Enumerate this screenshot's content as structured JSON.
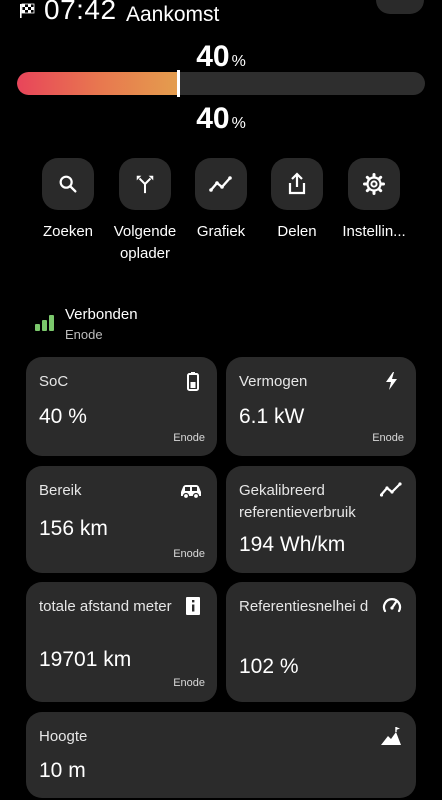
{
  "header": {
    "time": "07:42",
    "arrival_label": "Aankomst"
  },
  "battery": {
    "soc_top": "40",
    "soc_bottom": "40",
    "unit": "%",
    "level_percent": 40,
    "gradient_colors": [
      "#e8455a",
      "#e2b24d",
      "#a6d96a"
    ]
  },
  "actions": [
    {
      "label": "Zoeken",
      "icon": "search-icon"
    },
    {
      "label": "Volgende oplader",
      "icon": "fork-route-icon"
    },
    {
      "label": "Grafiek",
      "icon": "line-chart-icon"
    },
    {
      "label": "Delen",
      "icon": "share-icon"
    },
    {
      "label": "Instellin...",
      "icon": "gear-icon"
    }
  ],
  "status": {
    "title": "Verbonden",
    "subtitle": "Enode",
    "signal_color": "#7bc86c"
  },
  "cards": [
    {
      "title": "SoC",
      "value": "40 %",
      "source": "Enode",
      "icon": "battery-icon"
    },
    {
      "title": "Vermogen",
      "value": "6.1 kW",
      "source": "Enode",
      "icon": "lightning-icon"
    },
    {
      "title": "Bereik",
      "value": "156 km",
      "source": "Enode",
      "icon": "car-icon"
    },
    {
      "title": "Gekalibreerd referentieverbruik",
      "value": "194 Wh/km",
      "source": "",
      "icon": "trend-icon"
    },
    {
      "title": "totale afstand meter",
      "value": "19701 km",
      "source": "Enode",
      "icon": "info-icon"
    },
    {
      "title": "Referentiesnelhei d",
      "value": "102 %",
      "source": "",
      "icon": "gauge-icon"
    },
    {
      "title": "Hoogte",
      "value": "10 m",
      "source": "",
      "icon": "mountain-icon"
    }
  ]
}
